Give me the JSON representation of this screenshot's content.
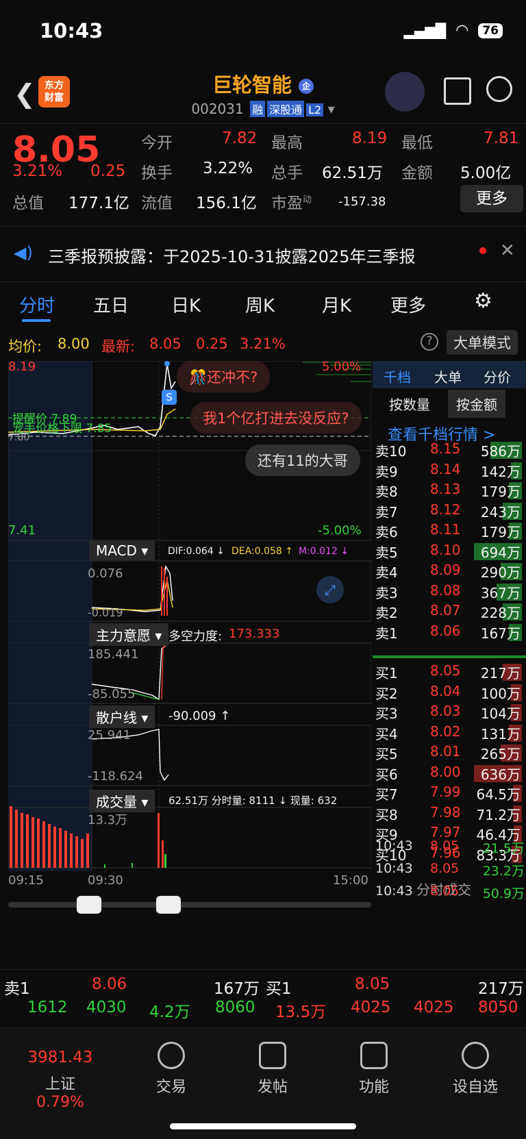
{
  "status": {
    "time": "10:43",
    "battery": "76"
  },
  "header": {
    "name": "巨轮智能",
    "badge": "企",
    "code": "002031",
    "tags": [
      "融",
      "深股通",
      "L2"
    ],
    "logo": "东方财富"
  },
  "quote": {
    "price": "8.05",
    "pct": "3.21%",
    "chg": "0.25",
    "open_l": "今开",
    "open": "7.82",
    "high_l": "最高",
    "high": "8.19",
    "low_l": "最低",
    "low": "7.81",
    "turn_l": "换手",
    "turn": "3.22%",
    "vol_l": "总手",
    "vol": "62.51万",
    "amt_l": "金额",
    "amt": "5.00亿",
    "mcap_l": "总值",
    "mcap": "177.1亿",
    "fcap_l": "流值",
    "fcap": "156.1亿",
    "pe_l": "市盈",
    "pe_sup": "动",
    "pe": "-157.38",
    "more": "更多"
  },
  "notice": "三季报预披露：于2025-10-31披露2025年三季报",
  "tabs": [
    "分时",
    "五日",
    "日K",
    "周K",
    "月K",
    "更多"
  ],
  "avg": {
    "avg_l": "均价:",
    "avg": "8.00",
    "last_l": "最新:",
    "last": "8.05",
    "chg": "0.25",
    "pct": "3.21%",
    "mode": "大单模式"
  },
  "chart": {
    "top": "8.19",
    "bottom": "7.41",
    "pct_top": "5.00%",
    "pct_bottom": "-5.00%",
    "remind": "提醒价 7.89",
    "limit": "宠手价格下限 7.85",
    "pre": "7.80",
    "bubbles": [
      "还冲不?",
      "我1个亿打进去没反应?",
      "还有11的大哥"
    ],
    "macd": {
      "label": "MACD",
      "dif": "DIF:0.064 ↓",
      "dea": "DEA:0.058 ↑",
      "m": "M:0.012 ↓",
      "top": "0.076",
      "bot": "-0.019"
    },
    "zl": {
      "label": "主力意愿",
      "desc_l": "多空力度:",
      "desc": "173.333",
      "top": "185.441",
      "bot": "-85.055"
    },
    "sh": {
      "label": "散户线",
      "val": "-90.009 ↑",
      "top": "25.941",
      "bot": "-118.624"
    },
    "vol": {
      "label": "成交量",
      "desc": "62.51万 分时量: 8111 ↓ 现量: 632",
      "top": "13.3万"
    },
    "times": [
      "09:15",
      "09:30",
      "15:00"
    ]
  },
  "obook": {
    "tabs": [
      "千档",
      "大单",
      "分价"
    ],
    "sub": [
      "按数量",
      "按金额"
    ],
    "link": "查看千档行情 >",
    "asks": [
      [
        "卖10",
        "8.15",
        "586万",
        0.6
      ],
      [
        "卖9",
        "8.14",
        "142万",
        0.1
      ],
      [
        "卖8",
        "8.13",
        "179万",
        0.15
      ],
      [
        "卖7",
        "8.12",
        "243万",
        0.3
      ],
      [
        "卖6",
        "8.11",
        "179万",
        0.15
      ],
      [
        "卖5",
        "8.10",
        "694万",
        1.0
      ],
      [
        "卖4",
        "8.09",
        "290万",
        0.35
      ],
      [
        "卖3",
        "8.08",
        "367万",
        0.45
      ],
      [
        "卖2",
        "8.07",
        "228万",
        0.3
      ],
      [
        "卖1",
        "8.06",
        "167万",
        0.15
      ]
    ],
    "bids": [
      [
        "买1",
        "8.05",
        "217万",
        0.3
      ],
      [
        "买2",
        "8.04",
        "100万",
        0.1
      ],
      [
        "买3",
        "8.03",
        "104万",
        0.1
      ],
      [
        "买4",
        "8.02",
        "131万",
        0.15
      ],
      [
        "买5",
        "8.01",
        "265万",
        0.35
      ],
      [
        "买6",
        "8.00",
        "636万",
        1.0
      ],
      [
        "买7",
        "7.99",
        "64.5万",
        0.05
      ],
      [
        "买8",
        "7.98",
        "71.2万",
        0.05
      ],
      [
        "买9",
        "7.97",
        "46.4万",
        0.03
      ],
      [
        "买10",
        "7.96",
        "83.3万",
        0.08
      ]
    ],
    "ticks_label": "分时成交",
    "ticks": [
      [
        "10:43",
        "8.05",
        "21.5万"
      ],
      [
        "10:43",
        "8.05",
        "23.2万"
      ],
      [
        "10:43",
        "8.05",
        "50.9万"
      ]
    ]
  },
  "bottom": {
    "ask_l": "卖1",
    "ask_p": "8.06",
    "ask_v": "167万",
    "bid_l": "买1",
    "bid_p": "8.05",
    "bid_v": "217万",
    "row1": [
      "1612",
      "4030",
      "4.2万",
      "8060",
      "13.5万",
      "4025",
      "4025",
      "8050"
    ]
  },
  "nav": {
    "index": "3981.43",
    "index_l": "上证",
    "index_pct": "0.79%",
    "items": [
      "交易",
      "发帖",
      "功能",
      "设自选"
    ]
  }
}
